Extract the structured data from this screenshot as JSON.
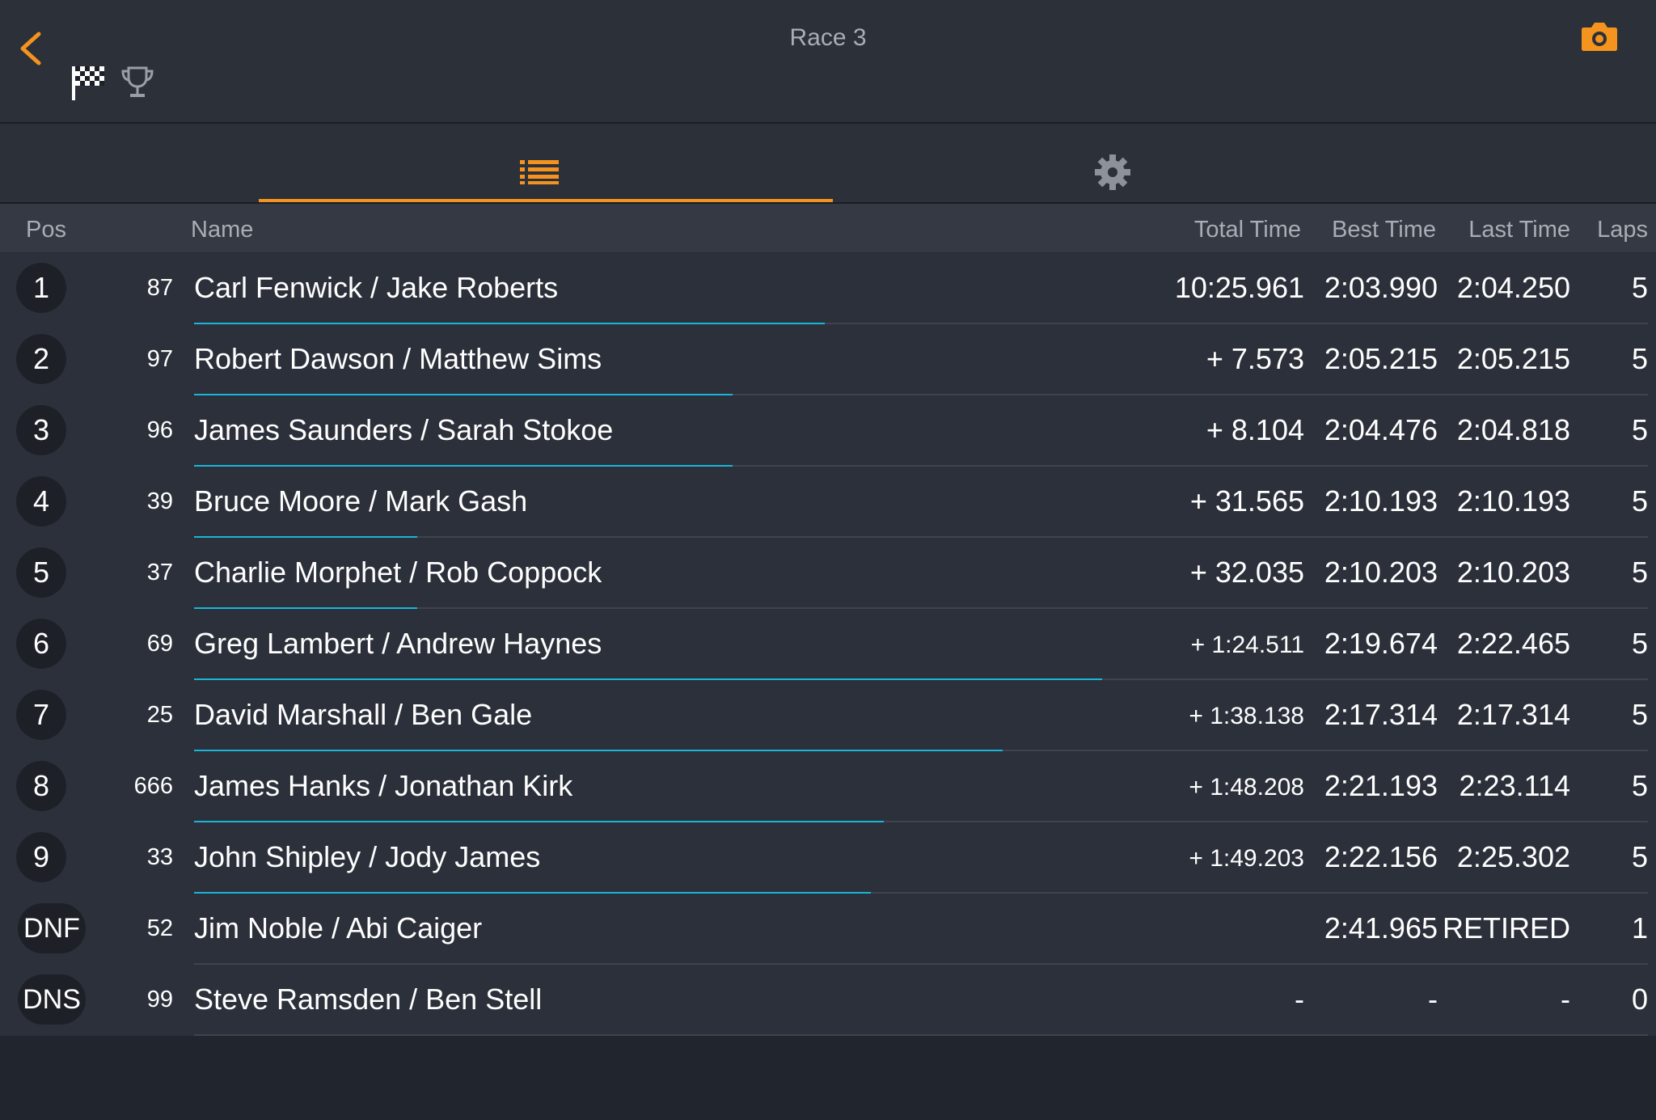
{
  "header": {
    "title": "Race 3",
    "accent_color": "#f4931e",
    "back_icon": "chevron-left-icon",
    "flag_icon": "checkered-flag-icon",
    "trophy_icon": "trophy-icon",
    "camera_icon": "camera-icon"
  },
  "tabs": [
    {
      "name": "list-icon",
      "active": true
    },
    {
      "name": "gear-icon",
      "active": false
    }
  ],
  "table": {
    "columns": {
      "pos": "Pos",
      "name": "Name",
      "total": "Total Time",
      "best": "Best Time",
      "last": "Last Time",
      "laps": "Laps"
    },
    "rows": [
      {
        "pos": "1",
        "num": "87",
        "name": "Carl Fenwick / Jake Roberts",
        "total": "10:25.961",
        "best": "2:03.990",
        "last": "2:04.250",
        "laps": "5",
        "progress": 0.75
      },
      {
        "pos": "2",
        "num": "97",
        "name": "Robert Dawson / Matthew Sims",
        "total": "+ 7.573",
        "best": "2:05.215",
        "last": "2:05.215",
        "laps": "5",
        "progress": 0.64
      },
      {
        "pos": "3",
        "num": "96",
        "name": "James Saunders / Sarah Stokoe",
        "total": "+ 8.104",
        "best": "2:04.476",
        "last": "2:04.818",
        "laps": "5",
        "progress": 0.64
      },
      {
        "pos": "4",
        "num": "39",
        "name": "Bruce Moore / Mark Gash",
        "total": "+ 31.565",
        "best": "2:10.193",
        "last": "2:10.193",
        "laps": "5",
        "progress": 0.265
      },
      {
        "pos": "5",
        "num": "37",
        "name": "Charlie Morphet / Rob Coppock",
        "total": "+ 32.035",
        "best": "2:10.203",
        "last": "2:10.203",
        "laps": "5",
        "progress": 0.265
      },
      {
        "pos": "6",
        "num": "69",
        "name": "Greg Lambert / Andrew Haynes",
        "total": "+ 1:24.511",
        "best": "2:19.674",
        "last": "2:22.465",
        "laps": "5",
        "progress": 1.08
      },
      {
        "pos": "7",
        "num": "25",
        "name": "David Marshall / Ben Gale",
        "total": "+ 1:38.138",
        "best": "2:17.314",
        "last": "2:17.314",
        "laps": "5",
        "progress": 0.962
      },
      {
        "pos": "8",
        "num": "666",
        "name": "James Hanks / Jonathan Kirk",
        "total": "+ 1:48.208",
        "best": "2:21.193",
        "last": "2:23.114",
        "laps": "5",
        "progress": 0.82
      },
      {
        "pos": "9",
        "num": "33",
        "name": "John Shipley / Jody James",
        "total": "+ 1:49.203",
        "best": "2:22.156",
        "last": "2:25.302",
        "laps": "5",
        "progress": 0.805
      },
      {
        "pos": "DNF",
        "num": "52",
        "name": "Jim Noble / Abi Caiger",
        "total": "",
        "best": "2:41.965",
        "last": "RETIRED",
        "laps": "1",
        "progress": 0
      },
      {
        "pos": "DNS",
        "num": "99",
        "name": "Steve Ramsden / Ben Stell",
        "total": "-",
        "best": "-",
        "last": "-",
        "laps": "0",
        "progress": 0
      }
    ]
  }
}
